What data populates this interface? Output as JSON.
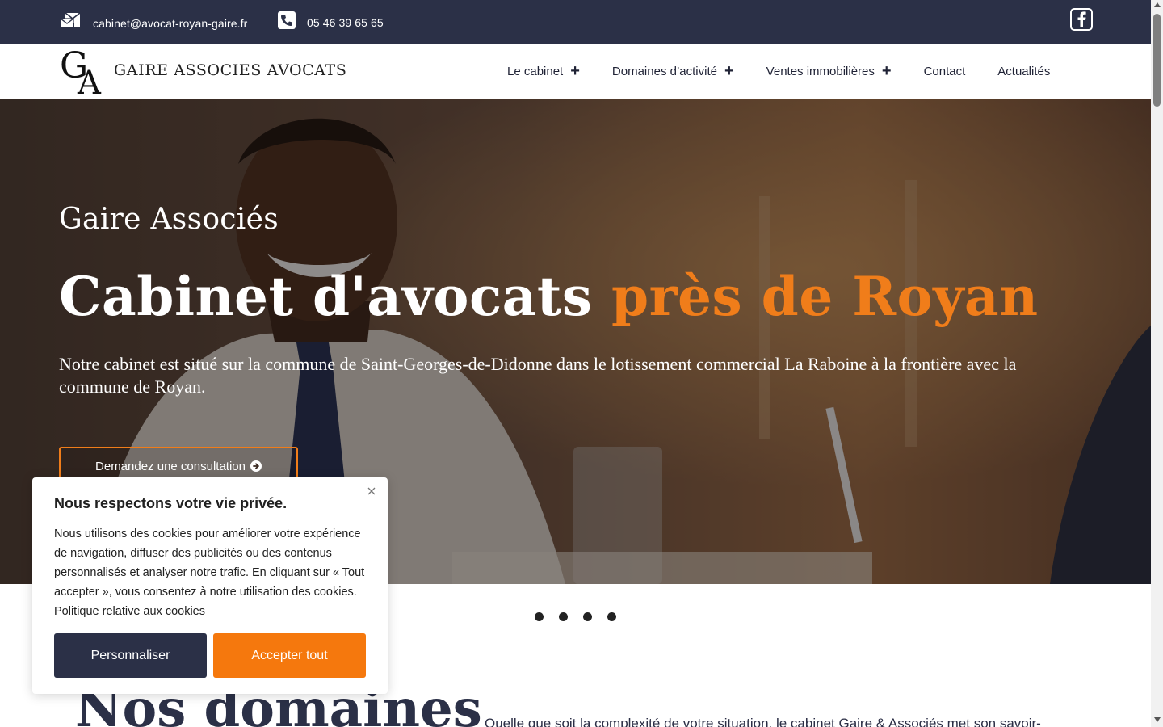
{
  "topbar": {
    "email": "cabinet@avocat-royan-gaire.fr",
    "phone": "05 46 39 65 65",
    "email_icon": "mail-stack-icon",
    "phone_icon": "phone-icon",
    "social_icon": "facebook-icon"
  },
  "header": {
    "brand": "GAIRE ASSOCIES AVOCATS",
    "logo_letters": "GA",
    "nav": [
      {
        "label": "Le cabinet",
        "has_submenu": true
      },
      {
        "label": "Domaines d’activité",
        "has_submenu": true
      },
      {
        "label": "Ventes immobilières",
        "has_submenu": true
      },
      {
        "label": "Contact",
        "has_submenu": false
      },
      {
        "label": "Actualités",
        "has_submenu": false
      }
    ],
    "submenu_icon": "+"
  },
  "hero": {
    "subtitle": "Gaire Associés",
    "title_main": "Cabinet d'avocats ",
    "title_accent": "près de Royan",
    "description": "Notre cabinet est situé sur la commune de Saint-Georges-de-Didonne dans le lotissement commercial La Raboine à la frontière avec la commune de Royan.",
    "cta_label": "Demandez une consultation",
    "slides_count": 4
  },
  "section": {
    "title": "Nos domaines",
    "intro": "Quelle que soit la complexité de votre situation, le cabinet Gaire & Associés met son savoir-"
  },
  "cookie": {
    "title": "Nous respectons votre vie privée.",
    "body": "Nous utilisons des cookies pour améliorer votre expérience de navigation, diffuser des publicités ou des contenus personnalisés et analyser notre trafic. En cliquant sur « Tout accepter », vous consentez à notre utilisation des cookies.",
    "link": "Politique relative aux cookies",
    "customize_label": "Personnaliser",
    "accept_label": "Accepter tout"
  },
  "colors": {
    "navy": "#2b3047",
    "accent": "#f07d1a",
    "accept": "#f5780d"
  }
}
